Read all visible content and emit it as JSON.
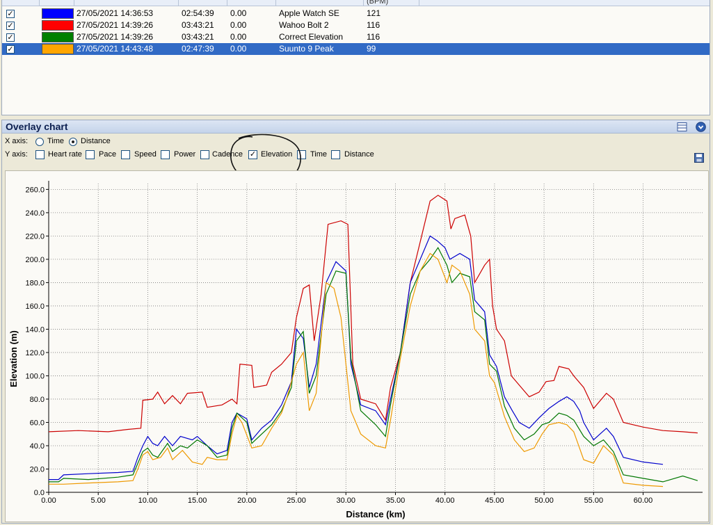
{
  "list": {
    "header_partial": "(BPM)",
    "rows": [
      {
        "checked": "✓",
        "color": "#0000ff",
        "start": "27/05/2021 14:36:53",
        "duration": "02:54:39",
        "value": "0.00",
        "device": "Apple Watch SE",
        "hr": "121"
      },
      {
        "checked": "✓",
        "color": "#ff0000",
        "start": "27/05/2021 14:39:26",
        "duration": "03:43:21",
        "value": "0.00",
        "device": "Wahoo Bolt 2",
        "hr": "116"
      },
      {
        "checked": "✓",
        "color": "#008000",
        "start": "27/05/2021 14:39:26",
        "duration": "03:43:21",
        "value": "0.00",
        "device": "Correct Elevation",
        "hr": "116"
      },
      {
        "checked": "✓",
        "color": "#ffa500",
        "start": "27/05/2021 14:43:48",
        "duration": "02:47:39",
        "value": "0.00",
        "device": "Suunto 9 Peak",
        "hr": "99"
      }
    ]
  },
  "overlay": {
    "title": "Overlay chart",
    "x_axis_label": "X axis:",
    "x_options": [
      "Time",
      "Distance"
    ],
    "x_selected": "Distance",
    "y_axis_label": "Y axis:",
    "y_options": [
      {
        "label": "Heart rate",
        "checked": false
      },
      {
        "label": "Pace",
        "checked": false
      },
      {
        "label": "Speed",
        "checked": false
      },
      {
        "label": "Power",
        "checked": false
      },
      {
        "label": "Cadence",
        "checked": false
      },
      {
        "label": "Elevation",
        "checked": true
      },
      {
        "label": "Time",
        "checked": false
      },
      {
        "label": "Distance",
        "checked": false
      }
    ],
    "icons": [
      "layout-icon",
      "dropdown-circle-icon",
      "save-icon"
    ]
  },
  "chart_data": {
    "type": "line",
    "xlabel": "Distance (km)",
    "ylabel": "Elevation (m)",
    "xlim": [
      0,
      66
    ],
    "ylim": [
      0,
      265
    ],
    "x_ticks": [
      "0.00",
      "5.00",
      "10.00",
      "15.00",
      "20.00",
      "25.00",
      "30.00",
      "35.00",
      "40.00",
      "45.00",
      "50.00",
      "55.00",
      "60.00"
    ],
    "y_ticks": [
      "0.0",
      "20.0",
      "40.0",
      "60.0",
      "80.0",
      "100.0",
      "120.0",
      "140.0",
      "160.0",
      "180.0",
      "200.0",
      "220.0",
      "240.0",
      "260.0"
    ],
    "grid": true,
    "series": [
      {
        "color": "#cc0000",
        "points": [
          [
            0,
            52
          ],
          [
            3,
            53
          ],
          [
            6,
            52
          ],
          [
            8,
            54
          ],
          [
            9.3,
            55
          ],
          [
            9.5,
            79
          ],
          [
            10.5,
            80
          ],
          [
            11,
            86
          ],
          [
            11.7,
            76
          ],
          [
            12.5,
            83
          ],
          [
            13.3,
            76
          ],
          [
            14,
            85
          ],
          [
            15.5,
            86
          ],
          [
            16,
            73
          ],
          [
            17.5,
            75
          ],
          [
            18.5,
            80
          ],
          [
            19,
            76
          ],
          [
            19.3,
            110
          ],
          [
            20.5,
            109
          ],
          [
            20.7,
            90
          ],
          [
            22,
            92
          ],
          [
            22.5,
            103
          ],
          [
            23.5,
            110
          ],
          [
            24.5,
            120
          ],
          [
            25,
            150
          ],
          [
            25.7,
            175
          ],
          [
            26.3,
            178
          ],
          [
            26.8,
            130
          ],
          [
            27.5,
            170
          ],
          [
            28.2,
            230
          ],
          [
            29.5,
            233
          ],
          [
            30.2,
            230
          ],
          [
            30.7,
            110
          ],
          [
            31.5,
            80
          ],
          [
            33,
            76
          ],
          [
            34,
            62
          ],
          [
            34.5,
            90
          ],
          [
            35.5,
            120
          ],
          [
            36.5,
            180
          ],
          [
            37.5,
            215
          ],
          [
            38.5,
            250
          ],
          [
            39.3,
            255
          ],
          [
            40.2,
            250
          ],
          [
            40.6,
            226
          ],
          [
            41,
            235
          ],
          [
            42,
            238
          ],
          [
            42.6,
            220
          ],
          [
            43,
            180
          ],
          [
            44,
            195
          ],
          [
            44.5,
            200
          ],
          [
            44.8,
            160
          ],
          [
            45.2,
            140
          ],
          [
            46,
            130
          ],
          [
            46.7,
            100
          ],
          [
            47.5,
            92
          ],
          [
            48.5,
            82
          ],
          [
            49.5,
            86
          ],
          [
            50.2,
            95
          ],
          [
            51,
            96
          ],
          [
            51.5,
            108
          ],
          [
            52.5,
            106
          ],
          [
            53,
            100
          ],
          [
            54,
            90
          ],
          [
            55,
            72
          ],
          [
            56.3,
            85
          ],
          [
            57,
            80
          ],
          [
            58,
            60
          ],
          [
            60,
            56
          ],
          [
            62,
            53
          ],
          [
            64,
            52
          ],
          [
            65.5,
            51
          ]
        ]
      },
      {
        "color": "#0000cc",
        "points": [
          [
            0,
            11
          ],
          [
            1,
            11
          ],
          [
            1.5,
            15
          ],
          [
            4,
            16
          ],
          [
            7,
            17
          ],
          [
            8.5,
            18
          ],
          [
            9,
            30
          ],
          [
            9.5,
            40
          ],
          [
            10,
            48
          ],
          [
            10.5,
            42
          ],
          [
            11,
            40
          ],
          [
            11.7,
            48
          ],
          [
            12.5,
            40
          ],
          [
            13.3,
            48
          ],
          [
            14.5,
            45
          ],
          [
            15,
            48
          ],
          [
            16,
            40
          ],
          [
            17,
            33
          ],
          [
            18,
            36
          ],
          [
            18.5,
            60
          ],
          [
            19,
            68
          ],
          [
            20,
            63
          ],
          [
            20.5,
            45
          ],
          [
            21.5,
            55
          ],
          [
            22.5,
            62
          ],
          [
            23.5,
            75
          ],
          [
            24.5,
            95
          ],
          [
            25,
            140
          ],
          [
            25.7,
            132
          ],
          [
            26.3,
            90
          ],
          [
            27,
            110
          ],
          [
            28,
            180
          ],
          [
            29,
            198
          ],
          [
            30,
            190
          ],
          [
            30.5,
            110
          ],
          [
            31.5,
            75
          ],
          [
            33,
            70
          ],
          [
            34,
            58
          ],
          [
            34.5,
            80
          ],
          [
            35.5,
            120
          ],
          [
            36.5,
            180
          ],
          [
            37.5,
            200
          ],
          [
            38.5,
            220
          ],
          [
            39.2,
            216
          ],
          [
            40,
            210
          ],
          [
            40.5,
            200
          ],
          [
            41.5,
            205
          ],
          [
            42.5,
            200
          ],
          [
            43,
            165
          ],
          [
            44,
            155
          ],
          [
            44.5,
            118
          ],
          [
            45.2,
            108
          ],
          [
            46,
            82
          ],
          [
            46.8,
            70
          ],
          [
            47.5,
            60
          ],
          [
            48.5,
            55
          ],
          [
            49.5,
            64
          ],
          [
            50.5,
            72
          ],
          [
            51.5,
            78
          ],
          [
            52.3,
            82
          ],
          [
            53,
            78
          ],
          [
            53.6,
            70
          ],
          [
            54,
            60
          ],
          [
            55,
            45
          ],
          [
            56.3,
            55
          ],
          [
            57,
            48
          ],
          [
            58,
            30
          ],
          [
            60,
            26
          ],
          [
            62,
            24
          ]
        ]
      },
      {
        "color": "#007700",
        "points": [
          [
            0,
            9
          ],
          [
            1,
            9
          ],
          [
            1.5,
            12
          ],
          [
            4,
            11
          ],
          [
            7,
            13
          ],
          [
            8.5,
            15
          ],
          [
            9,
            25
          ],
          [
            9.5,
            35
          ],
          [
            10,
            38
          ],
          [
            10.5,
            32
          ],
          [
            11,
            30
          ],
          [
            12,
            42
          ],
          [
            12.5,
            35
          ],
          [
            13.3,
            40
          ],
          [
            14,
            38
          ],
          [
            15,
            45
          ],
          [
            16,
            40
          ],
          [
            17,
            30
          ],
          [
            18,
            32
          ],
          [
            18.5,
            55
          ],
          [
            19,
            68
          ],
          [
            20,
            60
          ],
          [
            20.5,
            42
          ],
          [
            21.5,
            50
          ],
          [
            22.5,
            58
          ],
          [
            23.5,
            70
          ],
          [
            24.5,
            90
          ],
          [
            25,
            130
          ],
          [
            25.7,
            138
          ],
          [
            26.3,
            85
          ],
          [
            27,
            100
          ],
          [
            28,
            170
          ],
          [
            29,
            190
          ],
          [
            30,
            188
          ],
          [
            30.5,
            115
          ],
          [
            31.5,
            70
          ],
          [
            33,
            58
          ],
          [
            34,
            48
          ],
          [
            34.5,
            75
          ],
          [
            35.5,
            120
          ],
          [
            36.5,
            170
          ],
          [
            37.5,
            190
          ],
          [
            38.5,
            200
          ],
          [
            39.3,
            210
          ],
          [
            40.2,
            195
          ],
          [
            40.7,
            180
          ],
          [
            41.5,
            188
          ],
          [
            42.5,
            185
          ],
          [
            43,
            155
          ],
          [
            44,
            148
          ],
          [
            44.5,
            110
          ],
          [
            45.2,
            104
          ],
          [
            46,
            74
          ],
          [
            47,
            55
          ],
          [
            48,
            45
          ],
          [
            49,
            50
          ],
          [
            49.8,
            58
          ],
          [
            50.5,
            60
          ],
          [
            51.5,
            68
          ],
          [
            52.3,
            66
          ],
          [
            53,
            62
          ],
          [
            54,
            48
          ],
          [
            55,
            40
          ],
          [
            56,
            45
          ],
          [
            57,
            35
          ],
          [
            58,
            15
          ],
          [
            60,
            12
          ],
          [
            62,
            9
          ],
          [
            64,
            14
          ],
          [
            65.5,
            10
          ]
        ]
      },
      {
        "color": "#ee9900",
        "points": [
          [
            0,
            7
          ],
          [
            1.5,
            7
          ],
          [
            4,
            8
          ],
          [
            7,
            9
          ],
          [
            8.5,
            10
          ],
          [
            9,
            20
          ],
          [
            9.5,
            32
          ],
          [
            10,
            35
          ],
          [
            10.5,
            28
          ],
          [
            11.3,
            30
          ],
          [
            12,
            38
          ],
          [
            12.5,
            28
          ],
          [
            13.5,
            36
          ],
          [
            14.5,
            26
          ],
          [
            15.5,
            24
          ],
          [
            16,
            30
          ],
          [
            17,
            28
          ],
          [
            18,
            28
          ],
          [
            18.5,
            50
          ],
          [
            19,
            66
          ],
          [
            19.5,
            60
          ],
          [
            20.5,
            38
          ],
          [
            21.5,
            40
          ],
          [
            22.5,
            55
          ],
          [
            23.5,
            68
          ],
          [
            24,
            80
          ],
          [
            25,
            110
          ],
          [
            25.7,
            120
          ],
          [
            26.3,
            70
          ],
          [
            27,
            85
          ],
          [
            28,
            180
          ],
          [
            28.8,
            175
          ],
          [
            29.5,
            150
          ],
          [
            30.5,
            70
          ],
          [
            31.5,
            50
          ],
          [
            33,
            40
          ],
          [
            34,
            38
          ],
          [
            34.5,
            62
          ],
          [
            35.5,
            115
          ],
          [
            36.5,
            160
          ],
          [
            37.5,
            190
          ],
          [
            38.5,
            205
          ],
          [
            39.3,
            200
          ],
          [
            40.2,
            180
          ],
          [
            40.7,
            195
          ],
          [
            41.5,
            190
          ],
          [
            42.5,
            170
          ],
          [
            43,
            140
          ],
          [
            44,
            130
          ],
          [
            44.5,
            100
          ],
          [
            45,
            94
          ],
          [
            46,
            65
          ],
          [
            47,
            45
          ],
          [
            48,
            35
          ],
          [
            49,
            38
          ],
          [
            49.8,
            50
          ],
          [
            50.5,
            58
          ],
          [
            51.5,
            60
          ],
          [
            52.3,
            58
          ],
          [
            53,
            52
          ],
          [
            54,
            28
          ],
          [
            55,
            25
          ],
          [
            56,
            40
          ],
          [
            57,
            32
          ],
          [
            58,
            8
          ],
          [
            60,
            6
          ],
          [
            62,
            5
          ]
        ]
      }
    ]
  }
}
